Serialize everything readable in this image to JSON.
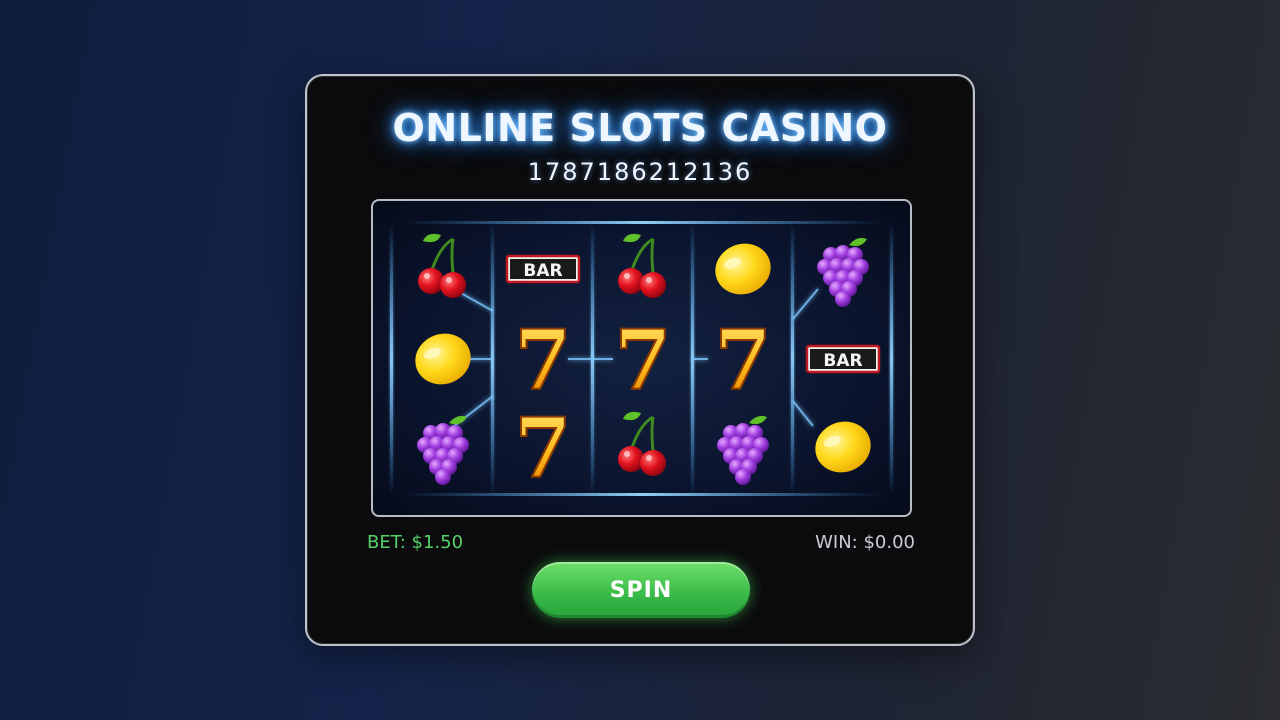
{
  "game": {
    "title": "ONLINE SLOTS CASINO",
    "subtitle": "1787186212136"
  },
  "reels": {
    "columns": [
      [
        "cherry-icon",
        "lemon-icon",
        "grapes-icon"
      ],
      [
        "bar-icon",
        "seven-icon",
        "seven-icon"
      ],
      [
        "cherry-icon",
        "seven-icon",
        "cherry-icon"
      ],
      [
        "lemon-icon",
        "seven-icon",
        "grapes-icon"
      ],
      [
        "grapes-icon",
        "bar-icon",
        "lemon-icon"
      ]
    ],
    "bar_label": "BAR",
    "seven_label": "7"
  },
  "stats": {
    "bet_label": "BET: $1.50",
    "win_label": "WIN: $0.00"
  },
  "controls": {
    "spin_label": "SPIN"
  },
  "colors": {
    "accent_green": "#56d16a",
    "glow_blue": "#3a9cff",
    "panel_bg": "#0b0b0d"
  }
}
